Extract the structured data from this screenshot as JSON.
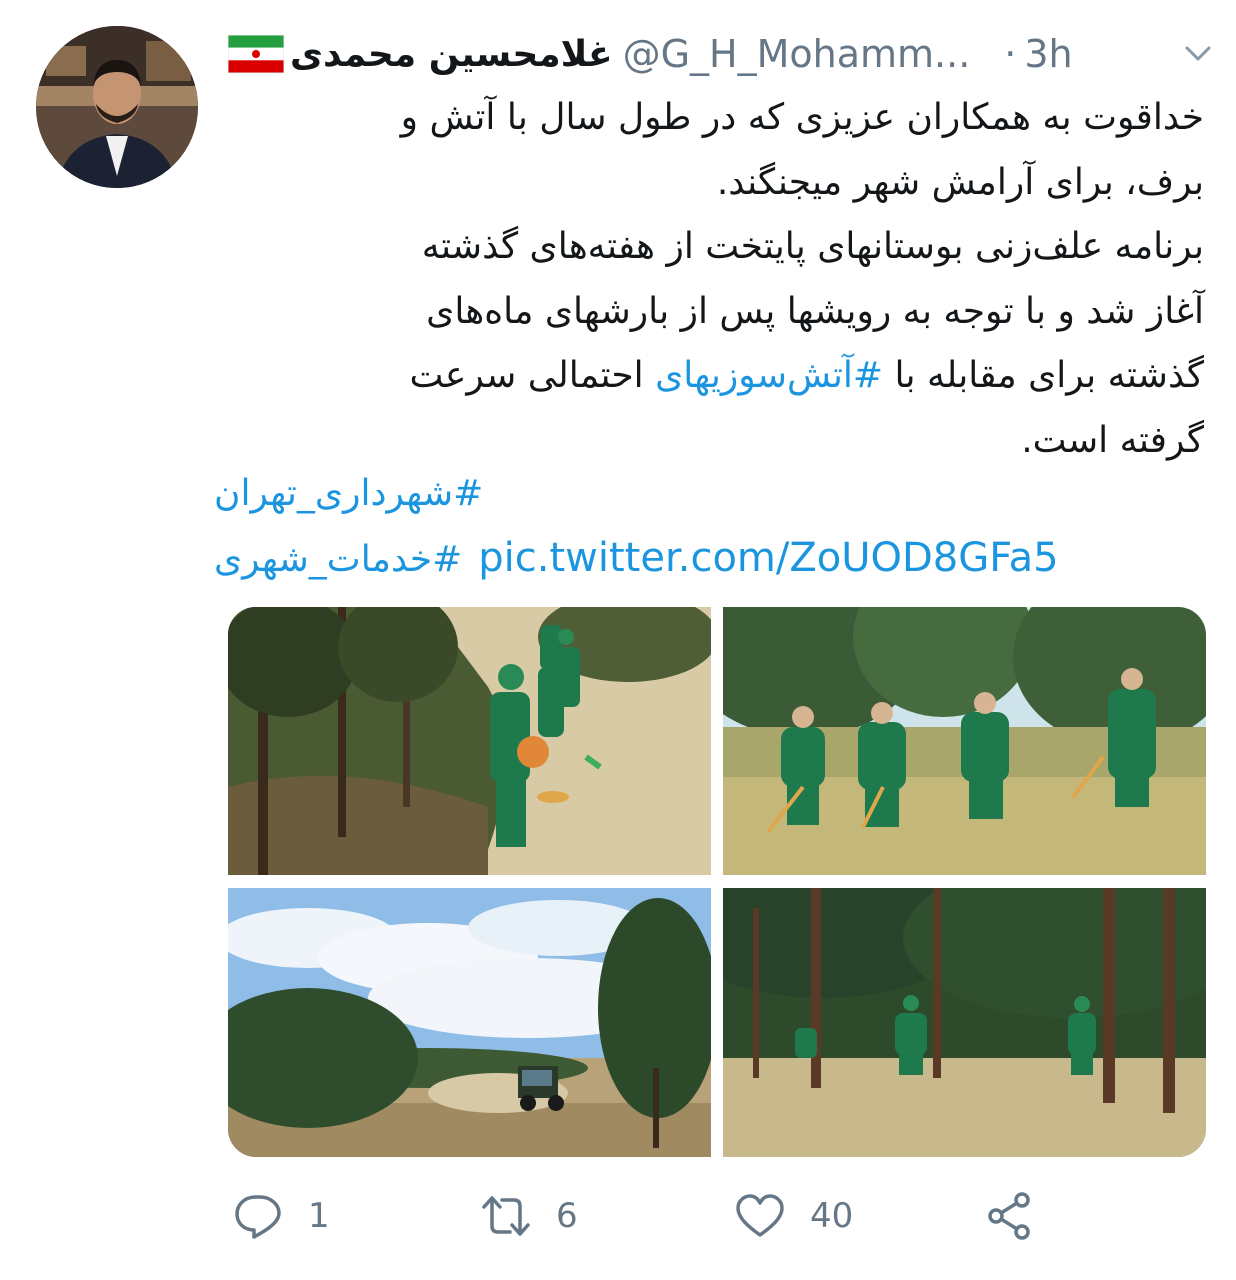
{
  "tweet": {
    "display_name": "غلامحسین محمدی",
    "handle": "@G_H_Mohamm...",
    "dot": "·",
    "time": "3h",
    "text_lines": {
      "l1": "خداقوت به همکاران عزیزی که در طول سال  با آتش و",
      "l2": "برف، برای آرامش شهر میجنگند.",
      "l3": "برنامه علف‌زنی بوستانهای پایتخت از هفته‌های گذشته",
      "l4": "آغاز شد و با توجه به رویشها پس از بارشهای ماه‌های",
      "l5_before": "گذشته برای مقابله با ",
      "l5_hashtag": "#آتش‌سوزیهای",
      "l5_after": " احتمالی سرعت",
      "l6": "گرفته است."
    },
    "hashtag_1": "#شهرداری_تهران",
    "hashtag_2": "#خدمات_شهری",
    "pic_link": "pic.twitter.com/ZoUOD8GFa5"
  },
  "actions": {
    "reply_count": "1",
    "retweet_count": "6",
    "like_count": "40"
  },
  "icons": {
    "avatar": "profile-photo",
    "flag": "iran-flag-icon",
    "caret": "chevron-down-icon",
    "reply": "reply-icon",
    "retweet": "retweet-icon",
    "like": "heart-icon",
    "share": "share-icon"
  },
  "colors": {
    "text": "#14171a",
    "secondary": "#657786",
    "link": "#1b95e0",
    "uniform_green": "#1e7a4c",
    "flag_green": "#239f40",
    "flag_red": "#da0000"
  }
}
